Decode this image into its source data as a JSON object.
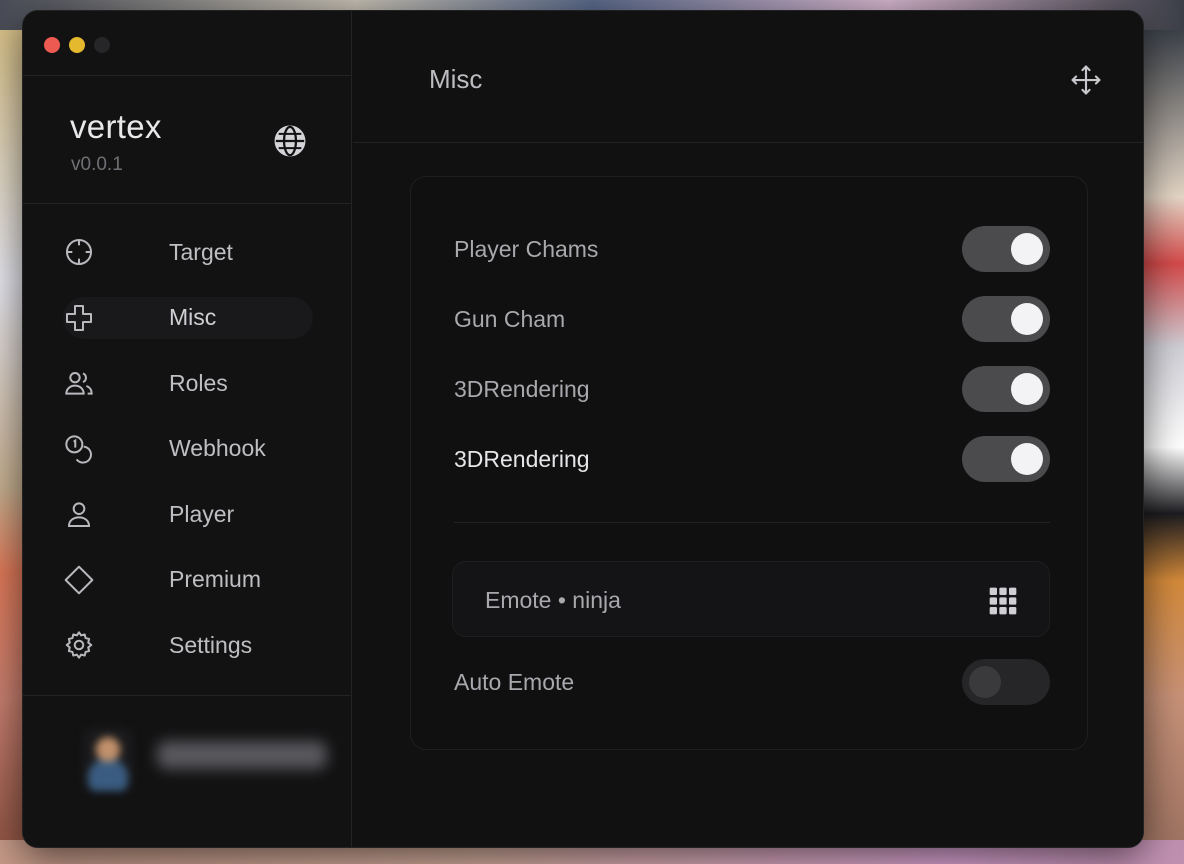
{
  "window": {
    "traffic_lights": [
      "close",
      "minimize",
      "zoom-disabled"
    ]
  },
  "brand": {
    "name": "vertex",
    "version": "v0.0.1",
    "language_icon": "globe-icon"
  },
  "nav": {
    "items": [
      {
        "label": "Target",
        "icon": "crosshair-icon",
        "active": false
      },
      {
        "label": "Misc",
        "icon": "plus-icon",
        "active": true
      },
      {
        "label": "Roles",
        "icon": "users-icon",
        "active": false
      },
      {
        "label": "Webhook",
        "icon": "coins-icon",
        "active": false
      },
      {
        "label": "Player",
        "icon": "user-icon",
        "active": false
      },
      {
        "label": "Premium",
        "icon": "diamond-icon",
        "active": false
      },
      {
        "label": "Settings",
        "icon": "gear-icon",
        "active": false
      }
    ]
  },
  "header": {
    "title": "Misc",
    "move_icon": "move-icon"
  },
  "settings": {
    "toggles": [
      {
        "label": "Player Chams",
        "on": true
      },
      {
        "label": "Gun Cham",
        "on": true
      },
      {
        "label": "3DRendering",
        "on": true
      },
      {
        "label": "3DRendering",
        "on": true,
        "highlighted": true
      }
    ],
    "emote_select": {
      "value": "Emote • ninja",
      "icon": "grid-icon"
    },
    "auto_emote": {
      "label": "Auto Emote",
      "on": false
    }
  },
  "colors": {
    "window_bg": "#111112",
    "accent_toggle": "#4b4b4e",
    "close": "#ed5a52",
    "minimize": "#e5b92e"
  }
}
